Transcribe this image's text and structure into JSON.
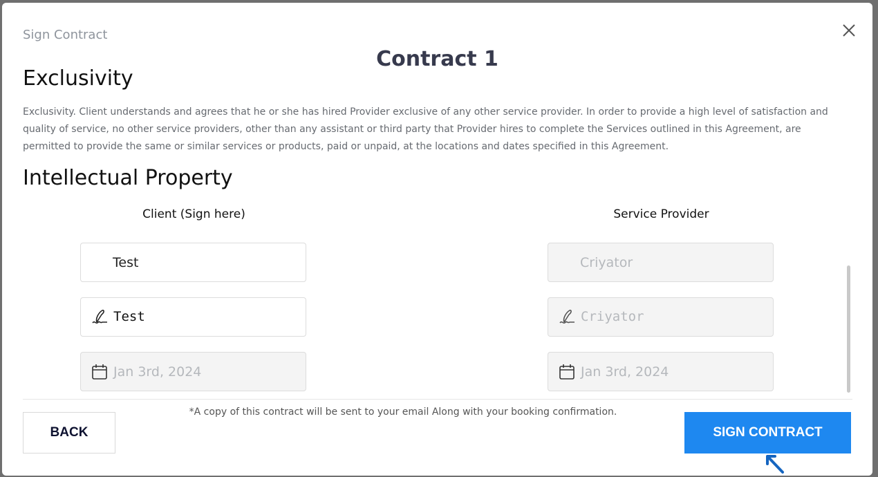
{
  "modal": {
    "label": "Sign Contract",
    "title": "Contract 1"
  },
  "sections": {
    "exclusivity": {
      "heading": "Exclusivity",
      "body": "Exclusivity. Client understands and agrees that he or she has hired Provider exclusive of any other service provider. In order to provide a high level of satisfaction and quality of service, no other service providers, other than any assistant or third party that Provider hires to complete the Services outlined in this Agreement, are permitted to provide the same or similar services or products, paid or unpaid, at the locations and dates specified in this Agreement."
    },
    "intellectual_property": {
      "heading": "Intellectual Property"
    }
  },
  "client": {
    "label": "Client (Sign here)",
    "name": "Test",
    "signature": "Test",
    "date": "Jan 3rd, 2024"
  },
  "provider": {
    "label": "Service Provider",
    "name": "Criyator",
    "signature": "Criyator",
    "date": "Jan 3rd, 2024"
  },
  "footer": {
    "note": "*A copy of this contract will be sent to your email Along with your booking confirmation.",
    "back_label": "BACK",
    "sign_label": "SIGN CONTRACT"
  },
  "colors": {
    "primary": "#1e88f0",
    "title": "#373a4d"
  },
  "icons": {
    "close": "close-icon",
    "signature": "signature-pen-icon",
    "calendar": "calendar-icon",
    "cursor": "mouse-pointer-icon"
  }
}
